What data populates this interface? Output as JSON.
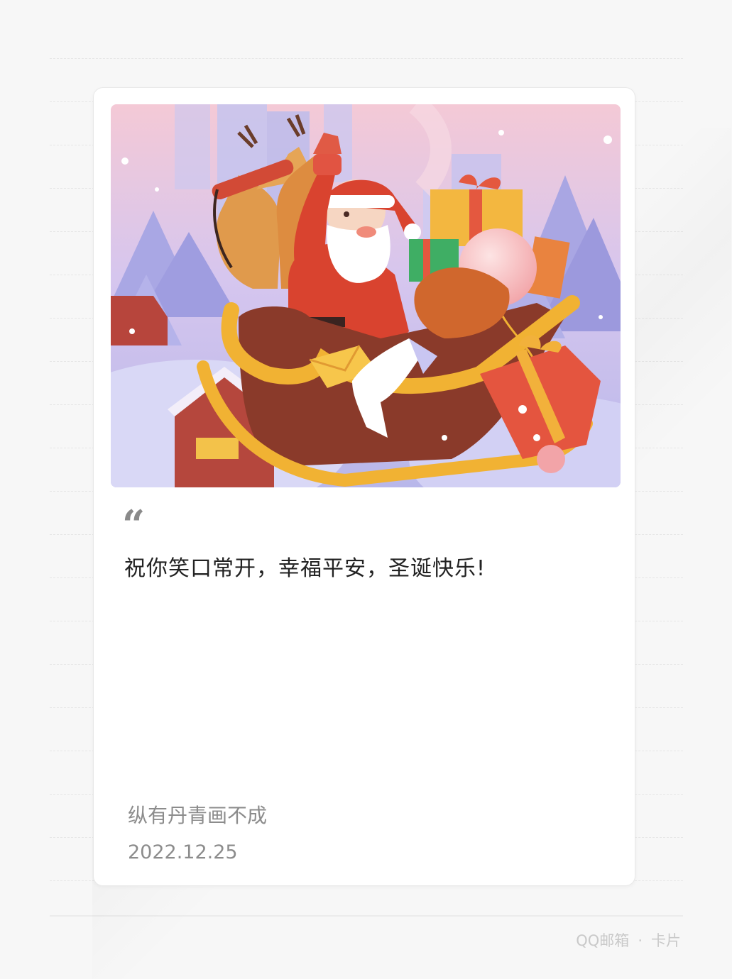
{
  "card": {
    "illustration": {
      "alt_icon": "santa-sleigh-illustration"
    },
    "quote_mark": "“",
    "message": "祝你笑口常开，幸福平安，圣诞快乐!",
    "signature": "纵有丹青画不成",
    "date": "2022.12.25"
  },
  "footer": {
    "brand": "QQ邮箱",
    "separator": "·",
    "section": "卡片"
  },
  "colors": {
    "background": "#f7f7f7",
    "card": "#ffffff",
    "text_primary": "#222222",
    "text_secondary": "#8c8c8c",
    "footer_text": "#c9c9c9",
    "sky_top": "#f4c9d6",
    "sky_mid": "#c9c4ee",
    "santa_red": "#d9432f",
    "sleigh_gold": "#f1b233",
    "sleigh_brown": "#8a3a2a"
  }
}
